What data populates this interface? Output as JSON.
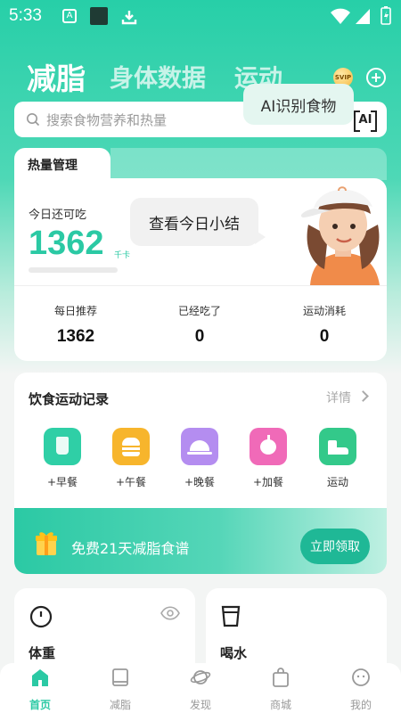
{
  "status_bar": {
    "time": "5:33"
  },
  "top_tabs": [
    {
      "label": "减脂",
      "active": true
    },
    {
      "label": "身体数据",
      "active": false
    },
    {
      "label": "运动",
      "active": false
    }
  ],
  "svip_badge": "SVIP",
  "search": {
    "placeholder": "搜索食物营养和热量",
    "ai_tooltip": "AI识别食物",
    "ai_button": "AI"
  },
  "calorie_card": {
    "tab_label": "热量管理",
    "remaining_label": "今日还可吃",
    "remaining_value": "1362",
    "remaining_unit": "千卡",
    "summary_bubble": "查看今日小结",
    "stats": [
      {
        "label": "每日推荐",
        "value": "1362"
      },
      {
        "label": "已经吃了",
        "value": "0"
      },
      {
        "label": "运动消耗",
        "value": "0"
      }
    ]
  },
  "records": {
    "title": "饮食运动记录",
    "detail": "详情",
    "items": [
      {
        "label": "+早餐",
        "icon": "cup-icon",
        "color": "#2fcfa6"
      },
      {
        "label": "+午餐",
        "icon": "burger-icon",
        "color": "#f7b52c"
      },
      {
        "label": "+晚餐",
        "icon": "cloche-icon",
        "color": "#b48df0"
      },
      {
        "label": "+加餐",
        "icon": "apple-icon",
        "color": "#f06ab8"
      },
      {
        "label": "运动",
        "icon": "shoe-icon",
        "color": "#33c98a"
      }
    ]
  },
  "promo": {
    "text": "免费21天减脂食谱",
    "button": "立即领取"
  },
  "mini_cards": [
    {
      "title": "体重",
      "icon": "scale-icon"
    },
    {
      "title": "喝水",
      "icon": "water-cup-icon"
    }
  ],
  "bottom_nav": [
    {
      "label": "首页",
      "icon": "home-icon",
      "active": true
    },
    {
      "label": "减脂",
      "icon": "book-icon",
      "active": false
    },
    {
      "label": "发现",
      "icon": "planet-icon",
      "active": false
    },
    {
      "label": "商城",
      "icon": "shopping-bag-icon",
      "active": false
    },
    {
      "label": "我的",
      "icon": "profile-face-icon",
      "active": false
    }
  ],
  "colors": {
    "accent": "#2bc9a4",
    "accent_dark": "#1fb896"
  }
}
